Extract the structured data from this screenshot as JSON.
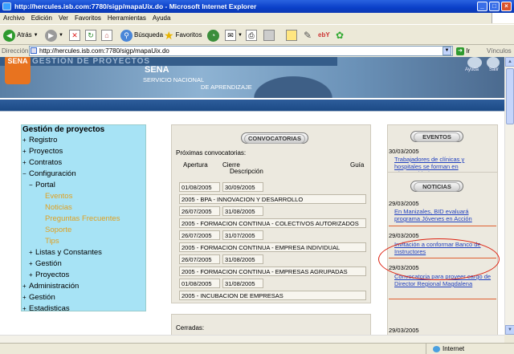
{
  "window": {
    "title": "http://hercules.isb.com:7780/sigp/mapaUix.do - Microsoft Internet Explorer",
    "buttons": {
      "min": "_",
      "max": "□",
      "close": "×"
    }
  },
  "menu": [
    "Archivo",
    "Edición",
    "Ver",
    "Favoritos",
    "Herramientas",
    "Ayuda"
  ],
  "toolbar": {
    "back": "Atrás",
    "search": "Búsqueda",
    "favorites": "Favoritos"
  },
  "address": {
    "label": "Dirección",
    "url": "http://hercules.isb.com:7780/sigp/mapaUix.do",
    "go": "Ir",
    "links": "Vínculos"
  },
  "status": {
    "zone": "Internet"
  },
  "banner": {
    "head": "GESTIÓN DE PROYECTOS",
    "logo": "SENA",
    "title": "SENA",
    "sub1": "SERVICIO NACIONAL",
    "sub2": "DE APRENDIZAJE",
    "icon1": "Ayuda",
    "icon2": "Salir"
  },
  "sidebar": {
    "title": "Gestión de proyectos",
    "items": [
      {
        "t": "+",
        "label": "Registro"
      },
      {
        "t": "+",
        "label": "Proyectos"
      },
      {
        "t": "+",
        "label": "Contratos"
      },
      {
        "t": "−",
        "label": "Configuración"
      },
      {
        "t": "−",
        "label": "Portal"
      },
      {
        "t": "",
        "label": "Eventos"
      },
      {
        "t": "",
        "label": "Noticias"
      },
      {
        "t": "",
        "label": "Preguntas Frecuentes"
      },
      {
        "t": "",
        "label": "Soporte"
      },
      {
        "t": "",
        "label": "Tips"
      },
      {
        "t": "+",
        "label": "Listas y Constantes"
      },
      {
        "t": "+",
        "label": "Gestión"
      },
      {
        "t": "+",
        "label": "Proyectos"
      },
      {
        "t": "+",
        "label": "Administración"
      },
      {
        "t": "+",
        "label": "Gestión"
      },
      {
        "t": "+",
        "label": "Estadisticas"
      }
    ]
  },
  "convocatorias": {
    "title": "CONVOCATORIAS",
    "proximas": "Próximas convocatorias:",
    "cols": {
      "apertura": "Apertura",
      "cierre": "Cierre",
      "descripcion": "Descripción",
      "guia": "Guía"
    },
    "rows": [
      {
        "open": "01/08/2005",
        "close": "30/09/2005",
        "desc": "2005 - BPA - INNOVACION Y DESARROLLO"
      },
      {
        "open": "26/07/2005",
        "close": "31/08/2005",
        "desc": "2005 - FORMACION CONTINUA - COLECTIVOS AUTORIZADOS"
      },
      {
        "open": "26/07/2005",
        "close": "31/07/2005",
        "desc": "2005 - FORMACION CONTINUA - EMPRESA INDIVIDUAL"
      },
      {
        "open": "26/07/2005",
        "close": "31/08/2005",
        "desc": "2005 - FORMACION CONTINUA - EMPRESAS AGRUPADAS"
      },
      {
        "open": "01/08/2005",
        "close": "31/08/2005",
        "desc": "2005 - INCUBACION DE EMPRESAS"
      }
    ],
    "cerradas": "Cerradas:"
  },
  "eventos": {
    "title": "EVENTOS",
    "date": "30/03/2005",
    "link": "Trabajadores de clínicas y hospitales se forman en Bioseguridad"
  },
  "noticias": {
    "title": "NOTICIAS",
    "items": [
      {
        "date": "29/03/2005",
        "link": "En Manizales, BID evaluará programa Jóvenes en Acción"
      },
      {
        "date": "29/03/2005",
        "link": "Invitación a conformar Banco de Instructores"
      },
      {
        "date": "29/03/2005",
        "link": "Convocatoria para proveer cargo de Director Regional Magdalena"
      },
      {
        "date": "29/03/2005",
        "link": ""
      }
    ]
  }
}
